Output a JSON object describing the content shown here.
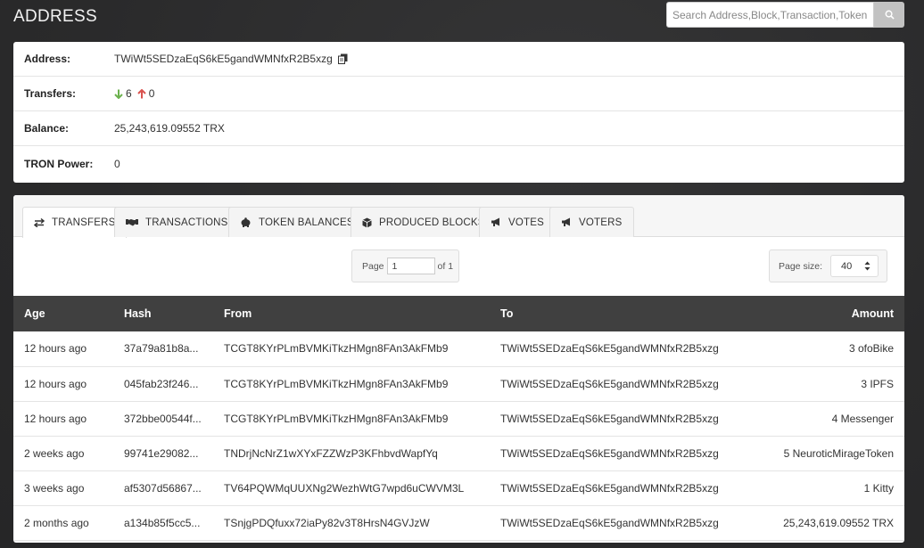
{
  "header": {
    "title": "ADDRESS",
    "search_placeholder": "Search Address,Block,Transaction,Token"
  },
  "info": {
    "address_label": "Address:",
    "address_value": "TWiWt5SEDzaEqS6kE5gandWMNfxR2B5xzg",
    "transfers_label": "Transfers:",
    "transfers_in": "6",
    "transfers_out": "0",
    "balance_label": "Balance:",
    "balance_value": "25,243,619.09552 TRX",
    "power_label": "TRON Power:",
    "power_value": "0"
  },
  "tabs": [
    {
      "label": "TRANSFERS",
      "icon": "transfer-arrows-icon",
      "active": true
    },
    {
      "label": "TRANSACTIONS",
      "icon": "handshake-icon",
      "active": false
    },
    {
      "label": "TOKEN BALANCES",
      "icon": "piggy-bank-icon",
      "active": false
    },
    {
      "label": "PRODUCED BLOCKS",
      "icon": "cube-icon",
      "active": false
    },
    {
      "label": "VOTES",
      "icon": "bullhorn-icon",
      "active": false
    },
    {
      "label": "VOTERS",
      "icon": "bullhorn-icon",
      "active": false
    }
  ],
  "pager": {
    "page_label": "Page",
    "page_value": "1",
    "of_label": "of 1",
    "size_label": "Page size:",
    "size_value": "40"
  },
  "table": {
    "columns": [
      "Age",
      "Hash",
      "From",
      "To",
      "Amount"
    ],
    "rows": [
      {
        "age": "12 hours ago",
        "hash": "37a79a81b8a...",
        "from": "TCGT8KYrPLmBVMKiTkzHMgn8FAn3AkFMb9",
        "to": "TWiWt5SEDzaEqS6kE5gandWMNfxR2B5xzg",
        "amount": "3 ofoBike"
      },
      {
        "age": "12 hours ago",
        "hash": "045fab23f246...",
        "from": "TCGT8KYrPLmBVMKiTkzHMgn8FAn3AkFMb9",
        "to": "TWiWt5SEDzaEqS6kE5gandWMNfxR2B5xzg",
        "amount": "3 IPFS"
      },
      {
        "age": "12 hours ago",
        "hash": "372bbe00544f...",
        "from": "TCGT8KYrPLmBVMKiTkzHMgn8FAn3AkFMb9",
        "to": "TWiWt5SEDzaEqS6kE5gandWMNfxR2B5xzg",
        "amount": "4 Messenger"
      },
      {
        "age": "2 weeks ago",
        "hash": "99741e29082...",
        "from": "TNDrjNcNrZ1wXYxFZZWzP3KFhbvdWapfYq",
        "to": "TWiWt5SEDzaEqS6kE5gandWMNfxR2B5xzg",
        "amount": "5 NeuroticMirageToken"
      },
      {
        "age": "3 weeks ago",
        "hash": "af5307d56867...",
        "from": "TV64PQWMqUUXNg2WezhWtG7wpd6uCWVM3L",
        "to": "TWiWt5SEDzaEqS6kE5gandWMNfxR2B5xzg",
        "amount": "1 Kitty"
      },
      {
        "age": "2 months ago",
        "hash": "a134b85f5cc5...",
        "from": "TSnjgPDQfuxx72iaPy82v3T8HrsN4GVJzW",
        "to": "TWiWt5SEDzaEqS6kE5gandWMNfxR2B5xzg",
        "amount": "25,243,619.09552 TRX"
      }
    ]
  },
  "colors": {
    "background": "#2b2b2c",
    "table_header": "#404040",
    "arrow_in": "#6bb14d",
    "arrow_out": "#d9534f"
  }
}
